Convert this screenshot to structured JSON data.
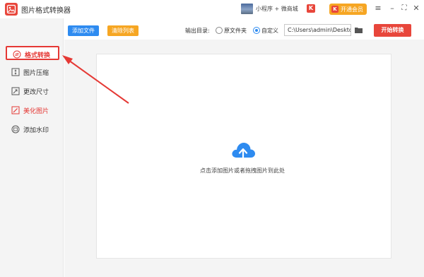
{
  "window": {
    "title": "图片格式转换器",
    "mini_program_text": "小程序 + 微商城",
    "k_badge": "K",
    "vip_badge": "K",
    "vip_label": "开通会员",
    "controls": {
      "menu": "≡",
      "minimize": "–",
      "maximize": "⛶",
      "close": "✕"
    }
  },
  "sidebar": {
    "items": [
      {
        "label": "格式转换",
        "icon": "format-convert-icon",
        "active": true
      },
      {
        "label": "图片压缩",
        "icon": "compress-icon",
        "active": false
      },
      {
        "label": "更改尺寸",
        "icon": "resize-icon",
        "active": false
      },
      {
        "label": "美化图片",
        "icon": "beautify-icon",
        "active": false
      },
      {
        "label": "添加水印",
        "icon": "watermark-icon",
        "active": false
      }
    ]
  },
  "toolbar": {
    "add_files": "添加文件",
    "clear_list": "清除列表",
    "output_dir_label": "输出目录:",
    "radio_original": "原文件夹",
    "radio_custom": "自定义",
    "selected_radio": "custom",
    "path_value": "C:\\Users\\admin\\Deskto",
    "start_button": "开始转换"
  },
  "dropzone": {
    "hint": "点击添加图片或者拖拽图片到此处",
    "icon": "cloud-upload-icon"
  },
  "colors": {
    "accent_red": "#e8463b",
    "blue": "#2e8bf0",
    "orange": "#f6a623",
    "annotation_red": "#e53935"
  }
}
